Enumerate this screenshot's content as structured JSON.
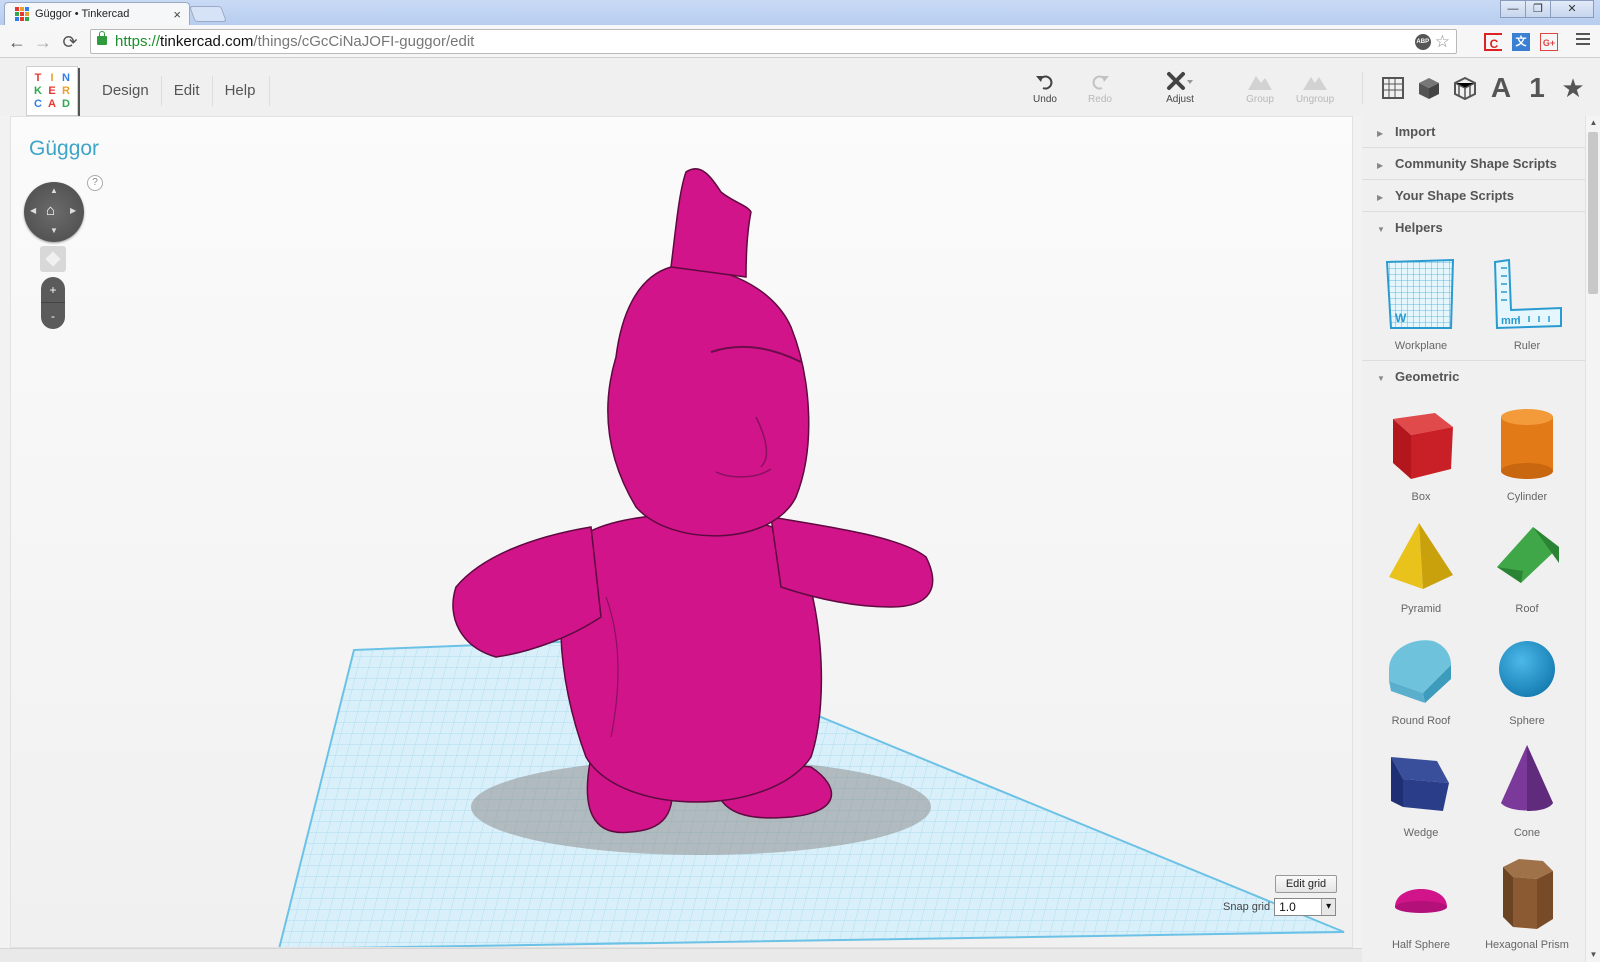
{
  "browser": {
    "tab_title": "Güggor • Tinkercad",
    "tab_close": "×",
    "url_scheme": "https://",
    "url_host": "tinkercad.com",
    "url_path": "/things/cGcCiNaJOFI-guggor/edit",
    "back": "←",
    "forward": "→",
    "reload": "⟳",
    "star": "☆",
    "adblock": "ABP",
    "ext1": "C",
    "ext2": "G+",
    "win_minimize": "—",
    "win_restore": "❐",
    "win_close": "✕"
  },
  "app": {
    "logo_letters": [
      "T",
      "I",
      "N",
      "K",
      "E",
      "R",
      "C",
      "A",
      "D"
    ],
    "logo_colors": [
      "#e8372f",
      "#e8a02f",
      "#2f7fe8",
      "#2fa84f",
      "#e8372f",
      "#e8a02f",
      "#2f7fe8",
      "#e8372f",
      "#2fa84f"
    ],
    "menu": [
      "Design",
      "Edit",
      "Help"
    ],
    "tools": {
      "undo": "Undo",
      "redo": "Redo",
      "adjust": "Adjust",
      "group": "Group",
      "ungroup": "Ungroup"
    },
    "view_text_icon": "A",
    "view_number_icon": "1",
    "view_star_icon": "★"
  },
  "workspace": {
    "design_title": "Güggor",
    "help_mark": "?",
    "zoom_in": "+",
    "zoom_out": "-",
    "edit_grid_label": "Edit grid",
    "snap_grid_label": "Snap grid",
    "snap_grid_value": "1.0",
    "model_color": "#d2148a",
    "grid_color": "#8fd2ee"
  },
  "panel": {
    "sections": {
      "import": "Import",
      "community": "Community Shape Scripts",
      "your_scripts": "Your Shape Scripts",
      "helpers": "Helpers",
      "geometric": "Geometric"
    },
    "helpers": [
      "Workplane",
      "Ruler"
    ],
    "shapes": [
      "Box",
      "Cylinder",
      "Pyramid",
      "Roof",
      "Round Roof",
      "Sphere",
      "Wedge",
      "Cone",
      "Half Sphere",
      "Hexagonal Prism"
    ],
    "workplane_mark": "W",
    "ruler_mark": "mm"
  }
}
